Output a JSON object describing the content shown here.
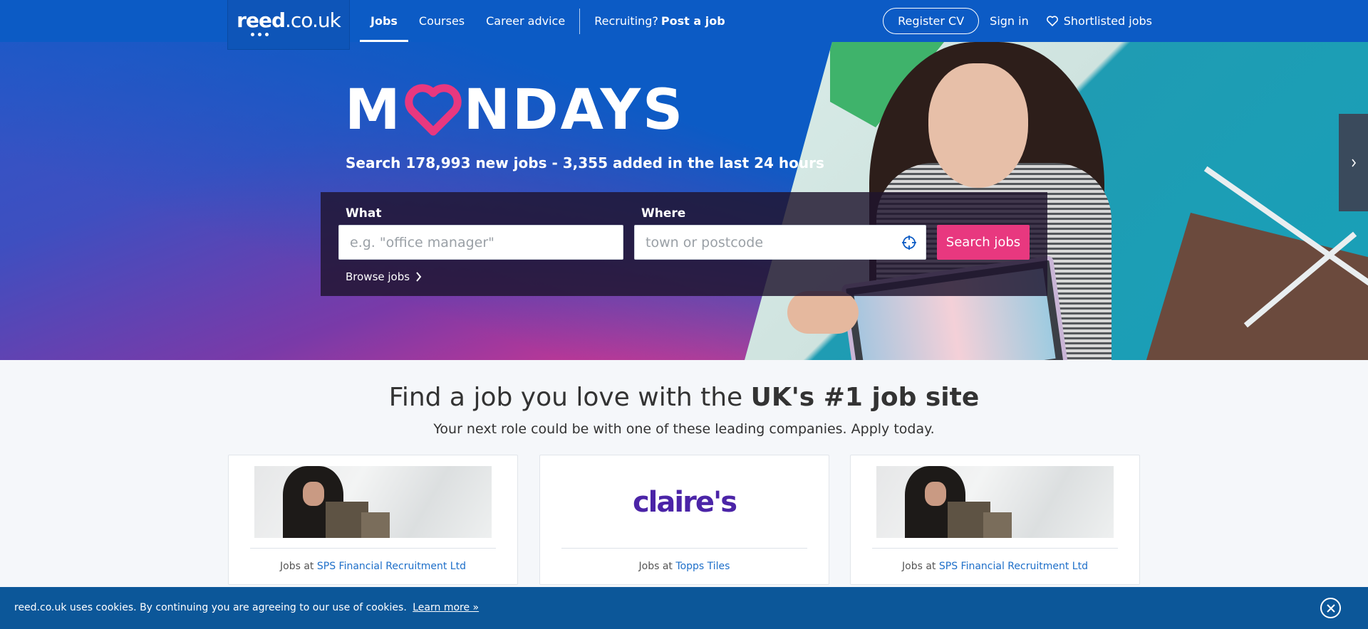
{
  "header": {
    "logo_bold": "reed",
    "logo_rest": ".co.uk",
    "nav": [
      {
        "label": "Jobs",
        "active": true
      },
      {
        "label": "Courses",
        "active": false
      },
      {
        "label": "Career advice",
        "active": false
      }
    ],
    "recruiting_prefix": "Recruiting?",
    "recruiting_link": "Post a job",
    "register_cv": "Register CV",
    "sign_in": "Sign in",
    "shortlisted": "Shortlisted jobs"
  },
  "hero": {
    "title_left": "M",
    "title_right": "NDAYS",
    "subtitle": "Search 178,993 new jobs - 3,355 added in the last 24 hours",
    "what_label": "What",
    "what_placeholder": "e.g. \"office manager\"",
    "where_label": "Where",
    "where_placeholder": "town or postcode",
    "search_button": "Search jobs",
    "browse_link": "Browse jobs",
    "accent_color": "#e8387f"
  },
  "main": {
    "tagline_prefix": "Find a job you love with the",
    "tagline_bold": "UK's #1 job site",
    "subline": "Your next role could be with one of these leading companies. Apply today.",
    "cards": [
      {
        "prefix": "Jobs at",
        "company": "SPS Financial Recruitment Ltd",
        "logo": "photo-banner"
      },
      {
        "prefix": "Jobs at",
        "company": "Topps Tiles",
        "logo_text": "claire's"
      },
      {
        "prefix": "Jobs at",
        "company": "SPS Financial Recruitment Ltd",
        "logo": "photo-banner"
      }
    ]
  },
  "cookie": {
    "message": "reed.co.uk uses cookies. By continuing you are agreeing to our use of cookies.",
    "link": "Learn more »",
    "close_icon": "close-circle-icon"
  },
  "icons": {
    "heart": "heart-outline-icon",
    "locate": "crosshair-icon",
    "chevron": "chevron-right-icon"
  }
}
